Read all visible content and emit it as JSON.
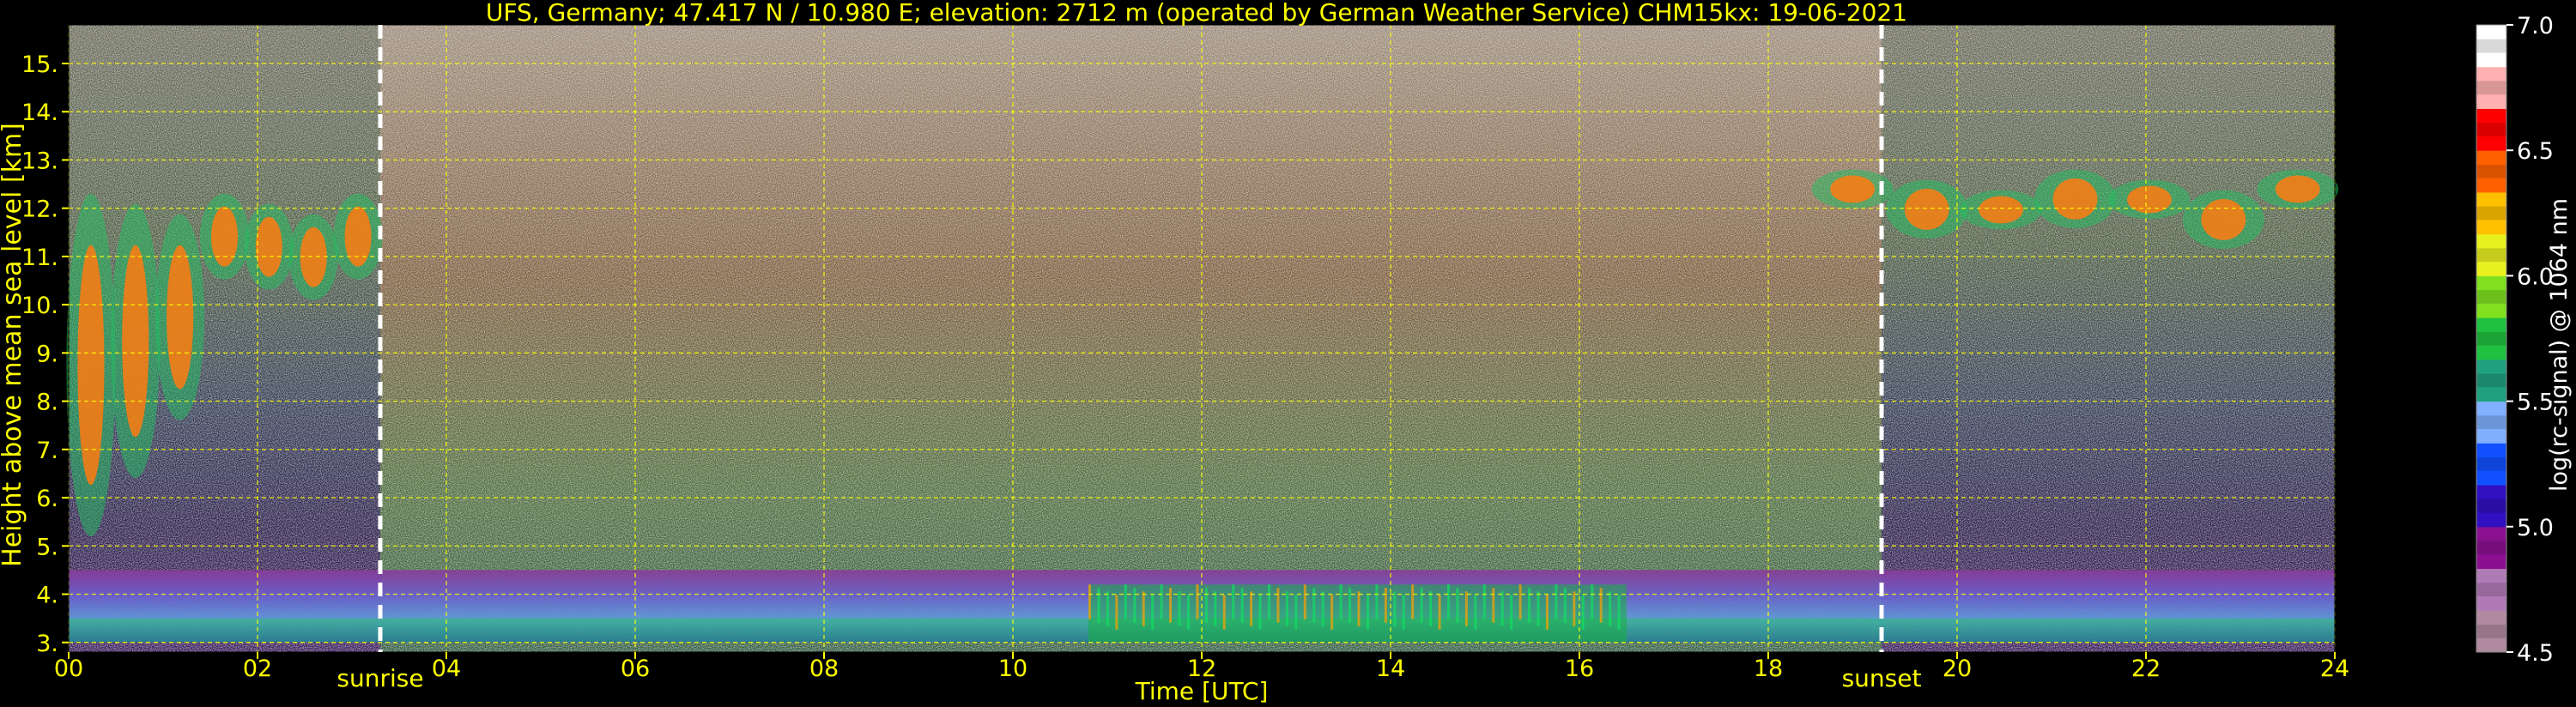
{
  "chart_data": {
    "type": "heatmap",
    "title": "UFS, Germany; 47.417 N / 10.980 E; elevation: 2712 m  (operated by German Weather Service)    CHM15kx: 19-06-2021",
    "xlabel": "Time [UTC]",
    "ylabel": "Height above mean sea level [km]",
    "xlim": [
      0,
      24
    ],
    "ylim": [
      2.8,
      15.8
    ],
    "x_ticks": [
      "00",
      "02",
      "04",
      "06",
      "08",
      "10",
      "12",
      "14",
      "16",
      "18",
      "20",
      "22",
      "24"
    ],
    "y_ticks": [
      "3.",
      "4.",
      "5.",
      "6.",
      "7.",
      "8.",
      "9.",
      "10.",
      "11.",
      "12.",
      "13.",
      "14.",
      "15."
    ],
    "grid": true,
    "colorbar": {
      "label": "log(rc-signal) @ 1064 nm",
      "range": [
        4.5,
        7.0
      ],
      "ticks": [
        "4.5",
        "5.0",
        "5.5",
        "6.0",
        "6.5",
        "7.0"
      ]
    },
    "events": [
      {
        "label": "sunrise",
        "time": 3.3
      },
      {
        "label": "sunset",
        "time": 19.2
      }
    ],
    "features": [
      {
        "kind": "boundary layer aerosol",
        "time": [
          0,
          24
        ],
        "height": [
          3.0,
          4.5
        ]
      },
      {
        "kind": "cirrus cloud",
        "time": [
          0,
          3.3
        ],
        "height": [
          5.2,
          12.3
        ]
      },
      {
        "kind": "cirrus cloud",
        "time": [
          18.5,
          24
        ],
        "height": [
          10.1,
          12.8
        ]
      },
      {
        "kind": "low cloud",
        "time": [
          10.8,
          16.5
        ],
        "height": [
          3.0,
          4.2
        ]
      }
    ]
  },
  "colors": {
    "background": "#000000",
    "axis_text": "#ffff00",
    "grid": "#ffff00",
    "event_line": "#ffffff",
    "colorbar_stops": [
      "#b08aa0",
      "#b07ab6",
      "#8a1090",
      "#3010c0",
      "#1050ff",
      "#80b0ff",
      "#20a080",
      "#20c040",
      "#80e020",
      "#e8f020",
      "#ffc000",
      "#ff6000",
      "#ff0000",
      "#ffb0b0",
      "#ffffff"
    ]
  }
}
